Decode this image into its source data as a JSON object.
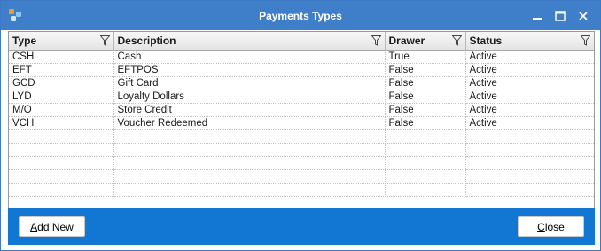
{
  "window": {
    "title": "Payments Types",
    "controls": [
      "minimize-icon",
      "maximize-icon",
      "close-icon"
    ]
  },
  "grid": {
    "columns": [
      {
        "label": "Type",
        "icon": "filter-icon"
      },
      {
        "label": "Description",
        "icon": "filter-icon"
      },
      {
        "label": "Drawer",
        "icon": "filter-icon"
      },
      {
        "label": "Status",
        "icon": "filter-icon"
      }
    ],
    "rows": [
      [
        "CSH",
        "Cash",
        "True",
        "Active"
      ],
      [
        "EFT",
        "EFTPOS",
        "False",
        "Active"
      ],
      [
        "GCD",
        "Gift Card",
        "False",
        "Active"
      ],
      [
        "LYD",
        "Loyalty Dollars",
        "False",
        "Active"
      ],
      [
        "M/O",
        "Store Credit",
        "False",
        "Active"
      ],
      [
        "VCH",
        "Voucher Redeemed",
        "False",
        "Active"
      ]
    ],
    "selected_row_index": 0
  },
  "footer": {
    "add_new": {
      "mnemonic": "A",
      "rest": "dd New"
    },
    "close": {
      "mnemonic": "C",
      "rest": "lose"
    }
  },
  "colors": {
    "titlebar": "#3f7fca",
    "footer": "#1177d2",
    "window_border": "#3d78c4"
  }
}
